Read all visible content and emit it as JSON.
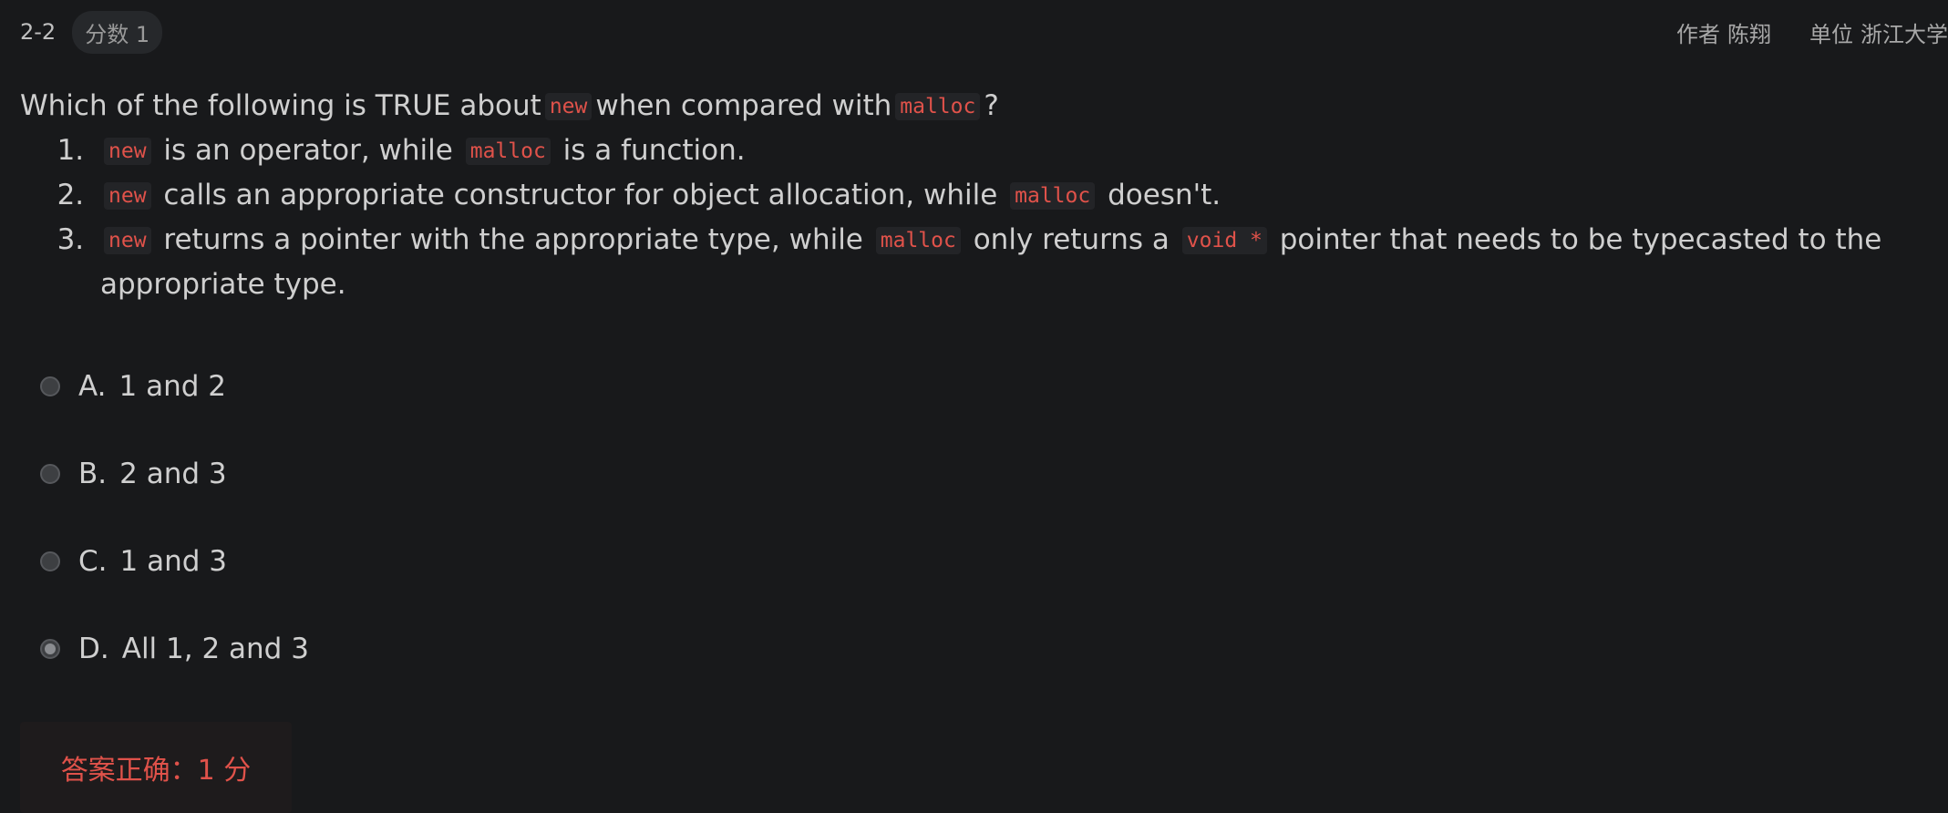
{
  "header": {
    "question_number": "2-2",
    "score_badge": "分数 1",
    "author_label": "作者",
    "author_value": "陈翔",
    "unit_label": "单位",
    "unit_value": "浙江大学"
  },
  "question": {
    "prefix": "Which of the following is TRUE about",
    "code_new": "new",
    "middle": "when compared with",
    "code_malloc": "malloc",
    "suffix": "?",
    "statements": [
      {
        "code1": "new",
        "text1": "is an operator, while",
        "code2": "malloc",
        "text2": "is a function."
      },
      {
        "code1": "new",
        "text1": "calls an appropriate constructor for object allocation, while",
        "code2": "malloc",
        "text2": "doesn't."
      },
      {
        "code1": "new",
        "text1": "returns a pointer with the appropriate type, while",
        "code2": "malloc",
        "text2": "only returns a",
        "code3": "void *",
        "text3": "pointer that needs to be typecasted to the appropriate type."
      }
    ]
  },
  "options": [
    {
      "letter": "A.",
      "text": "1 and 2",
      "selected": false
    },
    {
      "letter": "B.",
      "text": "2 and 3",
      "selected": false
    },
    {
      "letter": "C.",
      "text": "1 and 3",
      "selected": false
    },
    {
      "letter": "D.",
      "text": "All 1, 2 and 3",
      "selected": true
    }
  ],
  "result": {
    "text": "答案正确：1 分"
  },
  "colors": {
    "background": "#18191b",
    "code_text": "#e0524a",
    "result_text": "#e0524a"
  }
}
